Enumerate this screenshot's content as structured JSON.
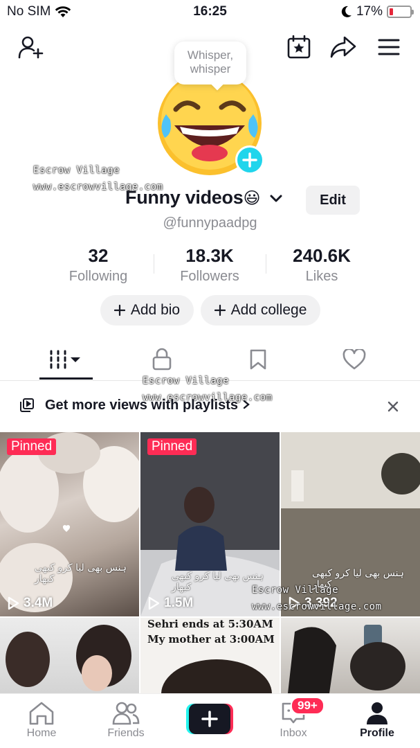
{
  "status_bar": {
    "carrier": "No SIM",
    "time": "16:25",
    "battery": "17%",
    "battery_level": 0.17
  },
  "profile": {
    "bubble_text": "Whisper, whisper",
    "display_name": "Funny videos",
    "name_emoji": "😃",
    "edit_label": "Edit",
    "username": "@funnypaadpg"
  },
  "watermark": {
    "line1": "Escrow Village",
    "line2": "www.escrowvillage.com"
  },
  "stats": [
    {
      "value": "32",
      "label": "Following"
    },
    {
      "value": "18.3K",
      "label": "Followers"
    },
    {
      "value": "240.6K",
      "label": "Likes"
    }
  ],
  "actions": {
    "add_bio": "Add bio",
    "add_college": "Add college"
  },
  "playlist_promo": {
    "text": "Get more views with playlists"
  },
  "videos": [
    {
      "pinned": "Pinned",
      "views": "3.4M",
      "caption": "ہنس بھی لیا کرو کبھی کبھار"
    },
    {
      "pinned": "Pinned",
      "views": "1.5M",
      "caption": "ہنس بھی لیا کرو کبھی کبھار"
    },
    {
      "views": "3,392",
      "caption": "ہنس بھی لیا کرو کبھی کبھار"
    },
    {},
    {
      "text_line1": "Sehri ends at 5:30AM",
      "text_line2": "My mother at 3:00AM"
    },
    {}
  ],
  "bottom_nav": {
    "home": "Home",
    "friends": "Friends",
    "inbox": "Inbox",
    "inbox_badge": "99+",
    "profile": "Profile"
  },
  "colors": {
    "accent": "#fe2c55",
    "cyan": "#25f4ee",
    "avatar_badge": "#20d5ec"
  }
}
